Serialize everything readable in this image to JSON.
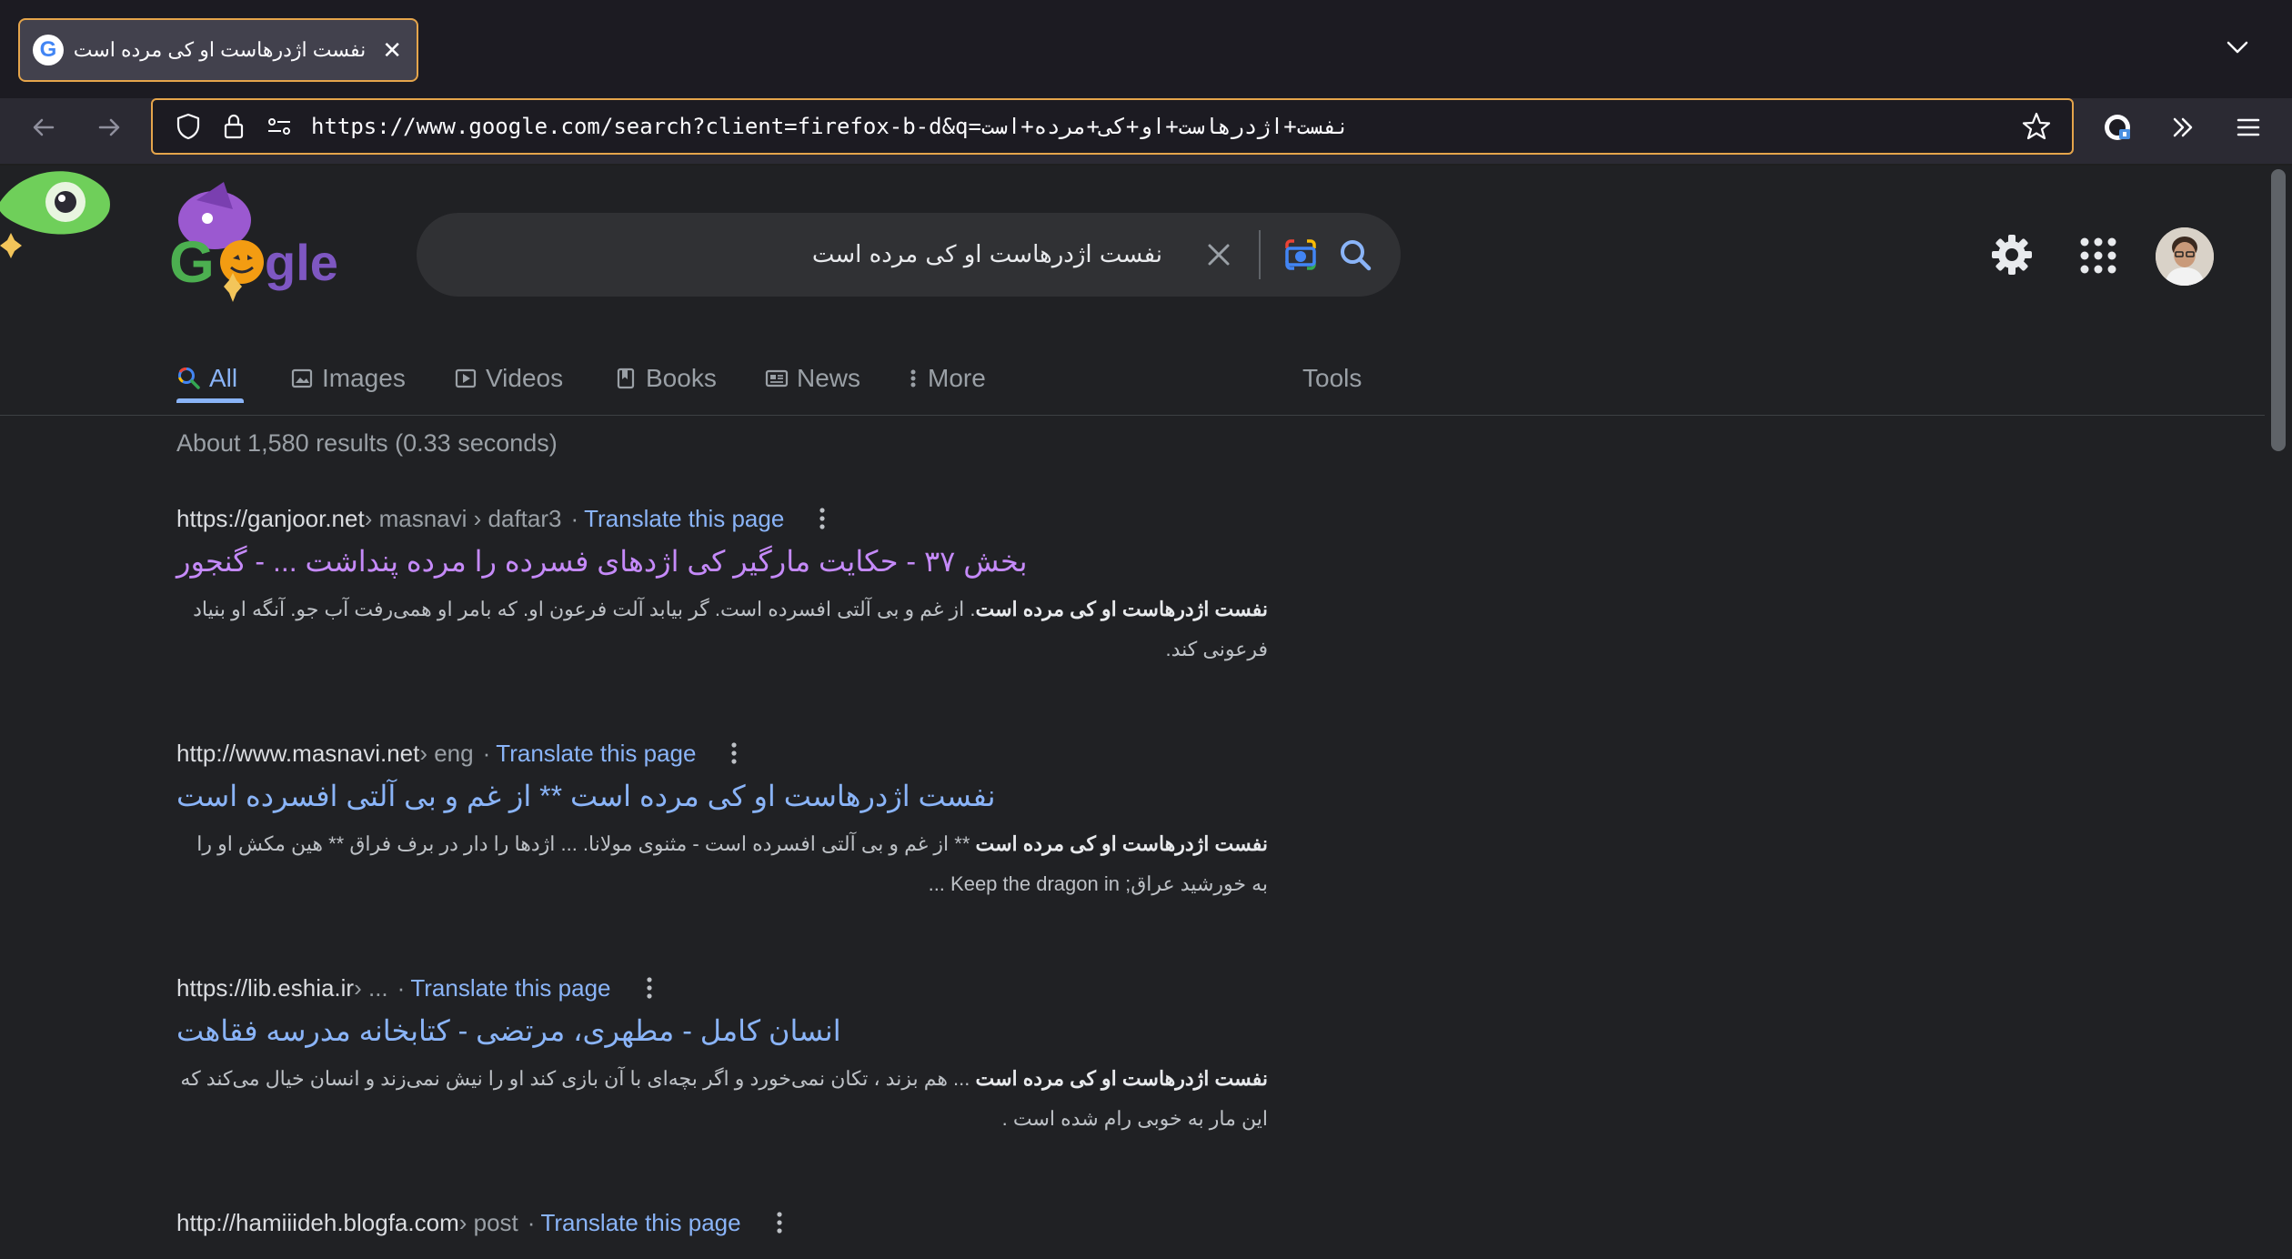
{
  "browser": {
    "tab_title": "نفست اژدرهاست او کی مرده است",
    "tab_favicon": "G",
    "url": "https://www.google.com/search?client=firefox-b-d&q=نفست+اژدرهاست+او+کی+مرده+است"
  },
  "search": {
    "query": "نفست اژدرهاست او کی مرده است"
  },
  "tabs": [
    {
      "label": "All"
    },
    {
      "label": "Images"
    },
    {
      "label": "Videos"
    },
    {
      "label": "Books"
    },
    {
      "label": "News"
    },
    {
      "label": "More"
    },
    {
      "label": "Tools"
    }
  ],
  "result_stats": "About 1,580 results (0.33 seconds)",
  "results": [
    {
      "site": "https://ganjoor.net",
      "path": " › masnavi › daftar3",
      "translate": "Translate this page",
      "title": "بخش ۳۷ - حکایت مارگیر کی اژدهای فسرده را مرده پنداشت ... - گنجور",
      "snippet_bold": "نفست اژدرهاست او کی مرده است",
      "snippet_rest": ". از غم و بی آلتی افسرده است. گر بیابد آلت فرعون او. که بامر او همی‌رفت آب جو. آنگه او بنیاد فرعونی کند."
    },
    {
      "site": "http://www.masnavi.net",
      "path": " › eng",
      "translate": "Translate this page",
      "title": "نفست اژدرهاست او کی مرده است ** از غم و بی آلتی افسرده است",
      "snippet_bold": "نفست اژدرهاست او کی مرده است",
      "snippet_rest": " ** از غم و بی آلتی افسرده است - مثنوی مولانا. ... اژدها را دار در برف فراق ** هین مکش او را به خورشید عراق; Keep the dragon in ..."
    },
    {
      "site": "https://lib.eshia.ir",
      "path": " › ...",
      "translate": "Translate this page",
      "title": "انسان کامل - مطهری، مرتضی - کتابخانه مدرسه فقاهت",
      "snippet_bold": "نفست اژدرهاست او کی مرده است",
      "snippet_rest": " ... هم بزند ، تکان نمی‌خورد و اگر بچه‌ای با آن بازی کند او را نیش نمی‌زند و انسان خیال می‌کند که این مار به خوبی رام شده است ."
    },
    {
      "site": "http://hamiiideh.blogfa.com",
      "path": " › post",
      "translate": "Translate this page",
      "title": "",
      "snippet_bold": "",
      "snippet_rest": ""
    }
  ]
}
